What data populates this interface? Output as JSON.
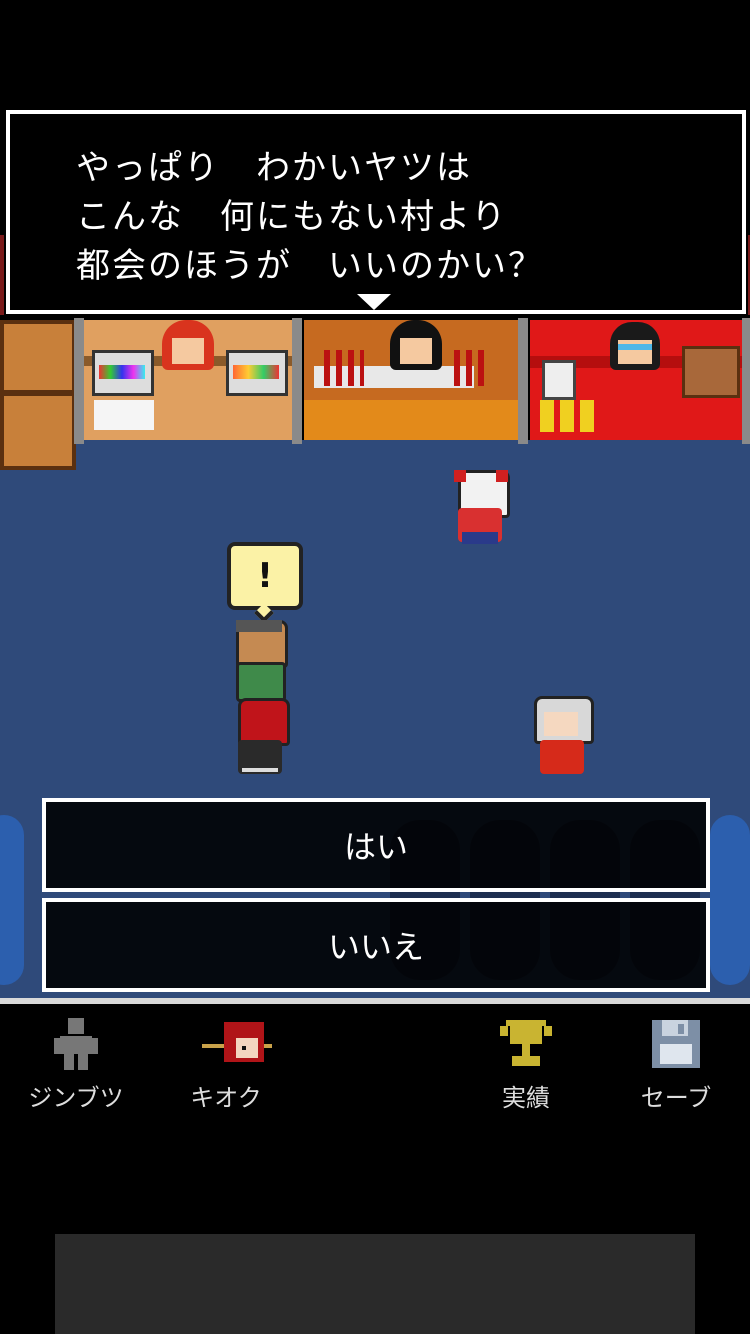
{
  "dialog": {
    "text": "やっぱり　わかいヤツは\nこんな　何にもない村より\n都会のほうが　いいのかい？"
  },
  "bubble": {
    "mark": "!"
  },
  "choices": {
    "yes": "はい",
    "no": "いいえ"
  },
  "nav": {
    "items": [
      {
        "label": "ジンブツ",
        "icon": "person-silhouette-icon"
      },
      {
        "label": "キオク",
        "icon": "memory-portrait-icon"
      },
      {
        "label": "実績",
        "icon": "trophy-icon"
      },
      {
        "label": "セーブ",
        "icon": "floppy-disk-icon"
      }
    ]
  },
  "colors": {
    "ground": "#2f4a7a",
    "bubble": "#fbf2a6",
    "trophy": "#c9b431",
    "floppy": "#7d8fa6"
  }
}
